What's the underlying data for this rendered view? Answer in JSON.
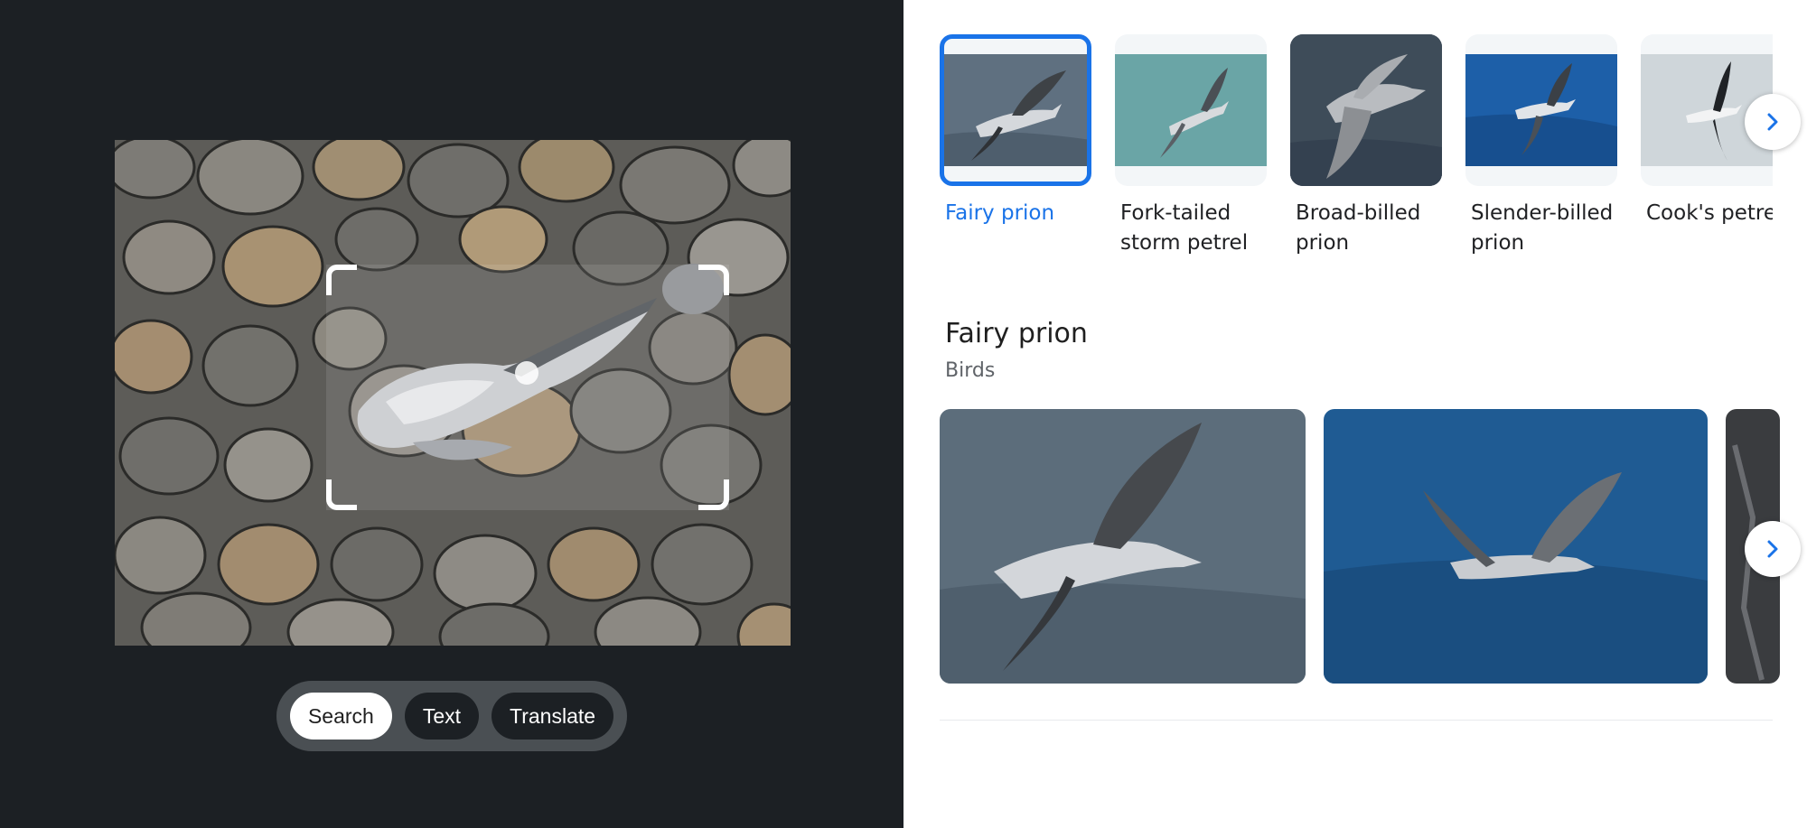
{
  "mode_bar": {
    "search": "Search",
    "text": "Text",
    "translate": "Translate"
  },
  "chips": [
    {
      "label": "Fairy prion",
      "selected": true
    },
    {
      "label": "Fork-tailed storm petrel",
      "selected": false
    },
    {
      "label": "Broad-billed prion",
      "selected": false
    },
    {
      "label": "Slender-billed prion",
      "selected": false
    },
    {
      "label": "Cook's petre",
      "selected": false
    }
  ],
  "result": {
    "title": "Fairy prion",
    "subtitle": "Birds"
  },
  "icons": {
    "next": "chevron-right-icon"
  },
  "colors": {
    "accent": "#1a73e8",
    "left_background": "#1c2024",
    "mode_bar": "#4a4f53"
  }
}
